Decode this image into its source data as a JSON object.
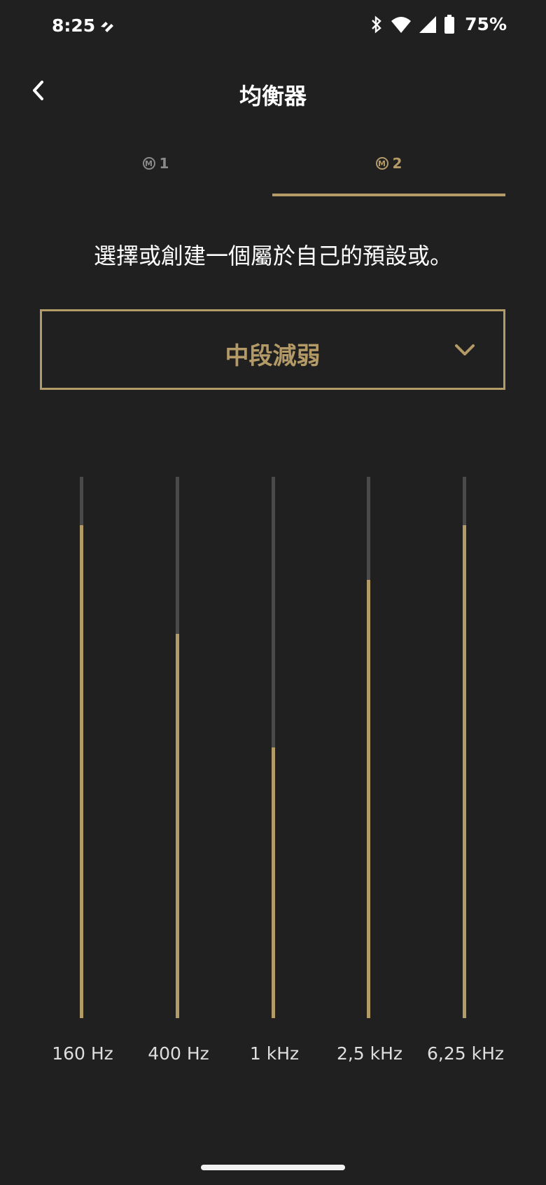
{
  "status_bar": {
    "time": "8:25",
    "battery_percent": "75%",
    "icons": [
      "vpn-icon",
      "bluetooth-icon",
      "wifi-icon",
      "signal-icon",
      "battery-icon"
    ]
  },
  "header": {
    "title": "均衡器",
    "back_icon": "chevron-left-icon"
  },
  "tabs": [
    {
      "label": "1",
      "badge": "M",
      "active": false
    },
    {
      "label": "2",
      "badge": "M",
      "active": true
    }
  ],
  "description": "選擇或創建一個屬於自己的預設或。",
  "preset": {
    "value": "中段減弱",
    "icon": "chevron-down-icon"
  },
  "equalizer": {
    "bands": [
      {
        "label": "160 Hz",
        "level": 0.91
      },
      {
        "label": "400 Hz",
        "level": 0.71
      },
      {
        "label": "1 kHz",
        "level": 0.5
      },
      {
        "label": "2,5 kHz",
        "level": 0.81
      },
      {
        "label": "6,25 kHz",
        "level": 0.91
      }
    ]
  },
  "colors": {
    "background": "#202020",
    "accent": "#b39a66",
    "track": "#4a4a4a",
    "text": "#ffffff"
  }
}
